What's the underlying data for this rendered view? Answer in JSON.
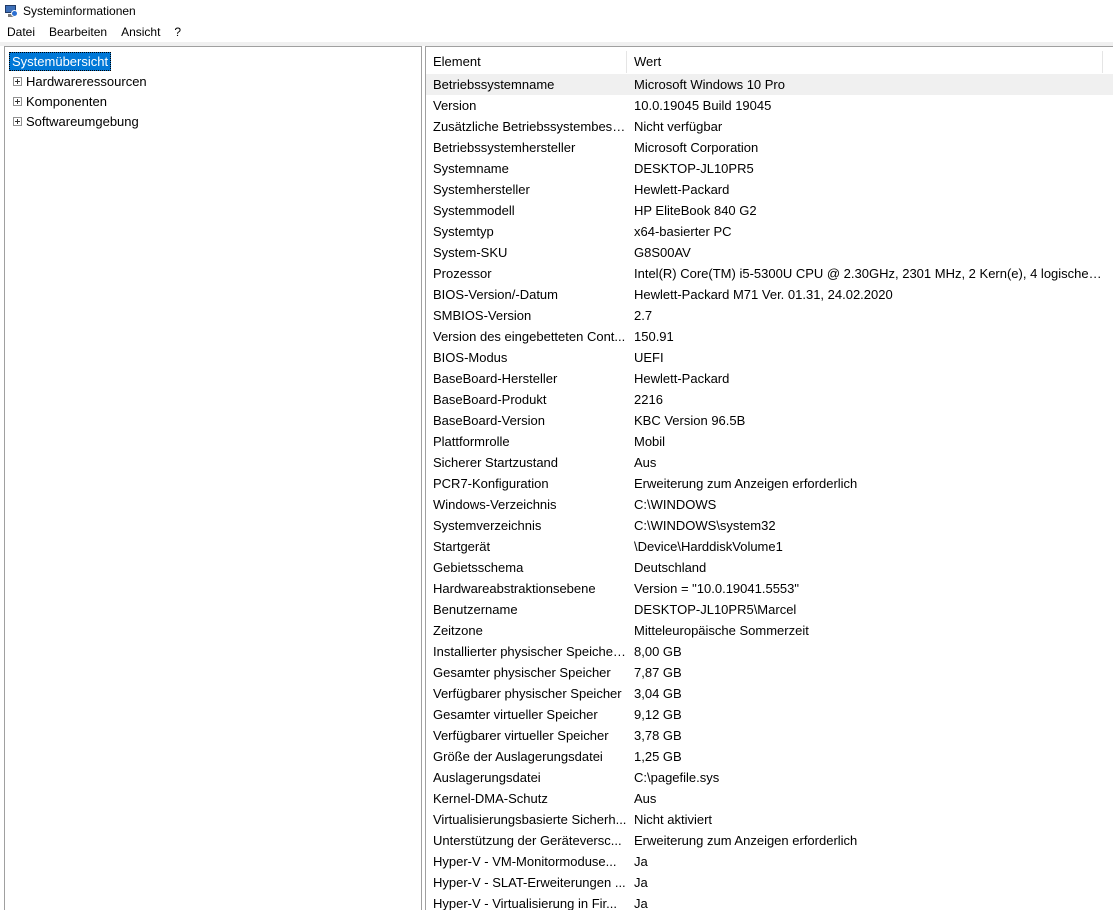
{
  "window": {
    "title": "Systeminformationen"
  },
  "menu": [
    "Datei",
    "Bearbeiten",
    "Ansicht",
    "?"
  ],
  "tree": {
    "root": "Systemübersicht",
    "children": [
      "Hardwareressourcen",
      "Komponenten",
      "Softwareumgebung"
    ]
  },
  "list": {
    "headers": {
      "element": "Element",
      "value": "Wert"
    },
    "rows": [
      [
        "Betriebssystemname",
        "Microsoft Windows 10 Pro"
      ],
      [
        "Version",
        "10.0.19045 Build 19045"
      ],
      [
        "Zusätzliche Betriebssystembesch...",
        "Nicht verfügbar"
      ],
      [
        "Betriebssystemhersteller",
        "Microsoft Corporation"
      ],
      [
        "Systemname",
        "DESKTOP-JL10PR5"
      ],
      [
        "Systemhersteller",
        "Hewlett-Packard"
      ],
      [
        "Systemmodell",
        "HP EliteBook 840 G2"
      ],
      [
        "Systemtyp",
        "x64-basierter PC"
      ],
      [
        "System-SKU",
        "G8S00AV"
      ],
      [
        "Prozessor",
        "Intel(R) Core(TM) i5-5300U CPU @ 2.30GHz, 2301 MHz, 2 Kern(e), 4 logische(r..."
      ],
      [
        "BIOS-Version/-Datum",
        "Hewlett-Packard M71 Ver. 01.31, 24.02.2020"
      ],
      [
        "SMBIOS-Version",
        "2.7"
      ],
      [
        "Version des eingebetteten Cont...",
        "150.91"
      ],
      [
        "BIOS-Modus",
        "UEFI"
      ],
      [
        "BaseBoard-Hersteller",
        "Hewlett-Packard"
      ],
      [
        "BaseBoard-Produkt",
        "2216"
      ],
      [
        "BaseBoard-Version",
        "KBC Version 96.5B"
      ],
      [
        "Plattformrolle",
        "Mobil"
      ],
      [
        "Sicherer Startzustand",
        "Aus"
      ],
      [
        "PCR7-Konfiguration",
        "Erweiterung zum Anzeigen erforderlich"
      ],
      [
        "Windows-Verzeichnis",
        "C:\\WINDOWS"
      ],
      [
        "Systemverzeichnis",
        "C:\\WINDOWS\\system32"
      ],
      [
        "Startgerät",
        "\\Device\\HarddiskVolume1"
      ],
      [
        "Gebietsschema",
        "Deutschland"
      ],
      [
        "Hardwareabstraktionsebene",
        "Version = \"10.0.19041.5553\""
      ],
      [
        "Benutzername",
        "DESKTOP-JL10PR5\\Marcel"
      ],
      [
        "Zeitzone",
        "Mitteleuropäische Sommerzeit"
      ],
      [
        "Installierter physischer Speicher...",
        "8,00 GB"
      ],
      [
        "Gesamter physischer Speicher",
        "7,87 GB"
      ],
      [
        "Verfügbarer physischer Speicher",
        "3,04 GB"
      ],
      [
        "Gesamter virtueller Speicher",
        "9,12 GB"
      ],
      [
        "Verfügbarer virtueller Speicher",
        "3,78 GB"
      ],
      [
        "Größe der Auslagerungsdatei",
        "1,25 GB"
      ],
      [
        "Auslagerungsdatei",
        "C:\\pagefile.sys"
      ],
      [
        "Kernel-DMA-Schutz",
        "Aus"
      ],
      [
        "Virtualisierungsbasierte Sicherh...",
        "Nicht aktiviert"
      ],
      [
        "Unterstützung der Geräteversc...",
        "Erweiterung zum Anzeigen erforderlich"
      ],
      [
        "Hyper-V - VM-Monitormoduse...",
        "Ja"
      ],
      [
        "Hyper-V - SLAT-Erweiterungen ...",
        "Ja"
      ],
      [
        "Hyper-V - Virtualisierung in Fir...",
        "Ja"
      ]
    ]
  }
}
